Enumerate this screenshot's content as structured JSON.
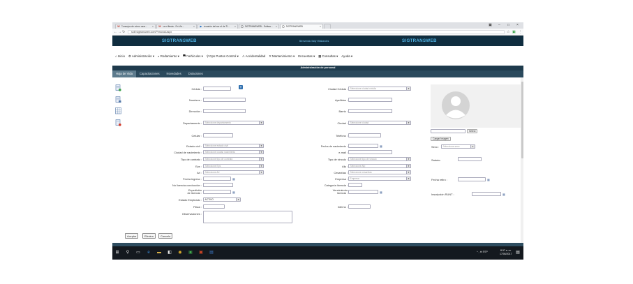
{
  "browser": {
    "tabs": [
      {
        "title": "Consejos de cómo usar...",
        "icon": "W",
        "color": "#c0392b"
      },
      {
        "title": "La et fiesta - En Viv...",
        "icon": "W",
        "color": "#c0392b"
      },
      {
        "title": "Invasión del sur el de Ti...",
        "icon": "▶",
        "color": "#1565c0"
      },
      {
        "title": "SIGTRANSWEB - Softwa...",
        "icon": "▢",
        "color": "#333"
      },
      {
        "title": "SIGTRANSWEB",
        "icon": "▢",
        "color": "#333"
      }
    ],
    "url": "sollf.sigtransweb.com/Personal.aspx",
    "window_controls": [
      "–",
      "□",
      "×"
    ]
  },
  "header": {
    "brand_left": "SIGTRANSWEB",
    "brand_right": "SIGTRANSWEB",
    "user_label": "Bienvenido Sally Villabaroles"
  },
  "menu": [
    {
      "icon": "home-icon",
      "glyph": "⌂",
      "label": "Inicio"
    },
    {
      "icon": "gear-icon",
      "glyph": "⚙",
      "label": "Administración ▾"
    },
    {
      "icon": "steering-icon",
      "glyph": "◐",
      "label": "Rodamiento ▾"
    },
    {
      "icon": "car-icon",
      "glyph": "⛟",
      "label": "Vehículos ▾"
    },
    {
      "icon": "location-icon",
      "glyph": "⚲",
      "label": "Gps Puntos Control ▾"
    },
    {
      "icon": "accident-icon",
      "glyph": "⚠",
      "label": "Accidentalidad"
    },
    {
      "icon": "wrench-icon",
      "glyph": "✕",
      "label": "Mantenimiento ▾"
    },
    {
      "icon": "survey-icon",
      "glyph": "",
      "label": "Encuestas ▾"
    },
    {
      "icon": "query-icon",
      "glyph": "▦",
      "label": "Consultas ▾"
    },
    {
      "icon": "help-icon",
      "glyph": "",
      "label": "Ayuda ▾"
    }
  ],
  "section_title": "Administración de personal",
  "subtabs": [
    "Hoja de Vida",
    "Capacitaciones",
    "Novedades",
    "Dotaciones"
  ],
  "form": {
    "cedula": "Cédula :",
    "ciudad_cedula": "Ciudad Cédula :",
    "ciudad_cedula_ph": "Seleccione ciudad cédula",
    "nombres": "Nombres :",
    "apellidos": "Apellidos :",
    "direccion": "Dirección :",
    "barrio": "Barrio :",
    "departamento": "Departamento :",
    "departamento_ph": "Seleccione departamento",
    "ciudad": "Ciudad :",
    "ciudad_ph": "Seleccione ciudad",
    "celular": "Celular :",
    "telefono": "Teléfono :",
    "estado_civil": "Estado civil :",
    "estado_civil_ph": "Seleccione estado civil",
    "fecha_nacimiento": "Fecha de nacimiento :",
    "ciudad_nacimiento": "Ciudad de nacimiento :",
    "ciudad_nacimiento_ph": "Seleccione ciudad nacimiento",
    "email": "e-mail :",
    "tipo_contrato": "Tipo de contrato :",
    "tipo_contrato_ph": "Seleccione tipo de contrato",
    "tipo_vinculo": "Tipo de vinculo :",
    "tipo_vinculo_ph": "Seleccione tipo de vinculo",
    "eps": "Eps :",
    "eps_ph": "Seleccione Eps",
    "afp": "Afp :",
    "afp_ph": "Seleccione Afp",
    "arl": "Arl :",
    "arl_ph": "Seleccione Arl",
    "cesantias": "Cesantías :",
    "cesantias_ph": "Seleccione cesantías",
    "fecha_ingreso": "Fecha ingreso :",
    "empresa": "Empresa :",
    "empresa_ph": "Empresa",
    "licencia": "No licencia conducción :",
    "categoria": "Categoría licencia :",
    "expedicion": "Expedición de licencia :",
    "vencimiento": "Vencimiento licencia :",
    "estado_empleado": "Estado Empleado :",
    "estado_empleado_val": "ACTIVO",
    "placa": "Placa :",
    "interno": "Interno :",
    "observaciones": "Observaciones :",
    "sexo": "Sexo :",
    "sexo_ph": "Seleccione sexo",
    "salario": "Salario :",
    "fecha_retiro": "Fecha retiro :",
    "inscripcion_runt": "Inscripción RUNT :",
    "select_btn": "Select",
    "cargar_imagen": "Cargar Imagen"
  },
  "actions": [
    "Aceptar",
    "Elimina",
    "Cancela"
  ],
  "taskbar": {
    "time": "8:37 a. m.",
    "date": "17/06/2017",
    "tray": "^ ⁁ ⊕ ESP"
  },
  "colors": {
    "header_bg": "#0f2d3f",
    "brand": "#4fb2e4",
    "section_bg": "#1e3a4c",
    "subtab_bg": "#2b4a5d",
    "subtab_active": "#5d7b8d"
  }
}
